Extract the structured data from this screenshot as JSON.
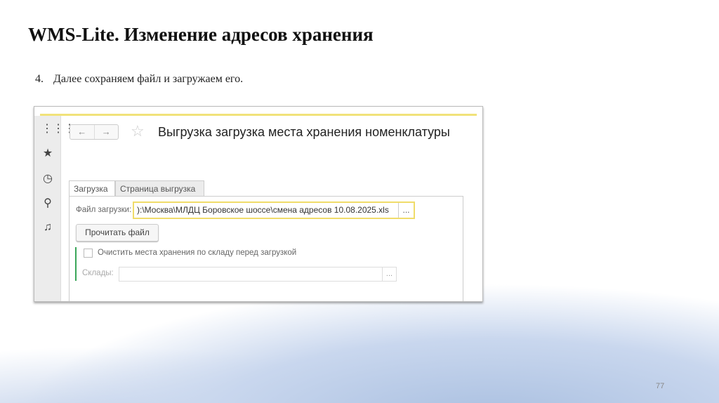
{
  "slide": {
    "title": "WMS-Lite. Изменение адресов хранения",
    "step_number": "4.",
    "step_text": "Далее сохраняем файл и загружаем его.",
    "page_number": "77"
  },
  "app": {
    "sidebar_icons": [
      "apps-grid-icon",
      "star-icon",
      "history-icon",
      "search-icon",
      "bell-icon"
    ],
    "nav": {
      "back": "←",
      "forward": "→"
    },
    "form_title": "Выгрузка загрузка места хранения номенклатуры",
    "tabs": [
      {
        "label": "Загрузка",
        "active": true
      },
      {
        "label": "Страница выгрузка",
        "active": false
      }
    ],
    "file_label": "Файл загрузки:",
    "file_value": "):\\Москва\\МЛДЦ Боровское шоссе\\смена адресов 10.08.2025.xls",
    "select_button": "...",
    "read_button": "Прочитать файл",
    "clear_checkbox": {
      "label": "Очистить места хранения по складу перед загрузкой",
      "checked": false
    },
    "warehouses_label": "Склады:",
    "warehouses_value": ""
  }
}
